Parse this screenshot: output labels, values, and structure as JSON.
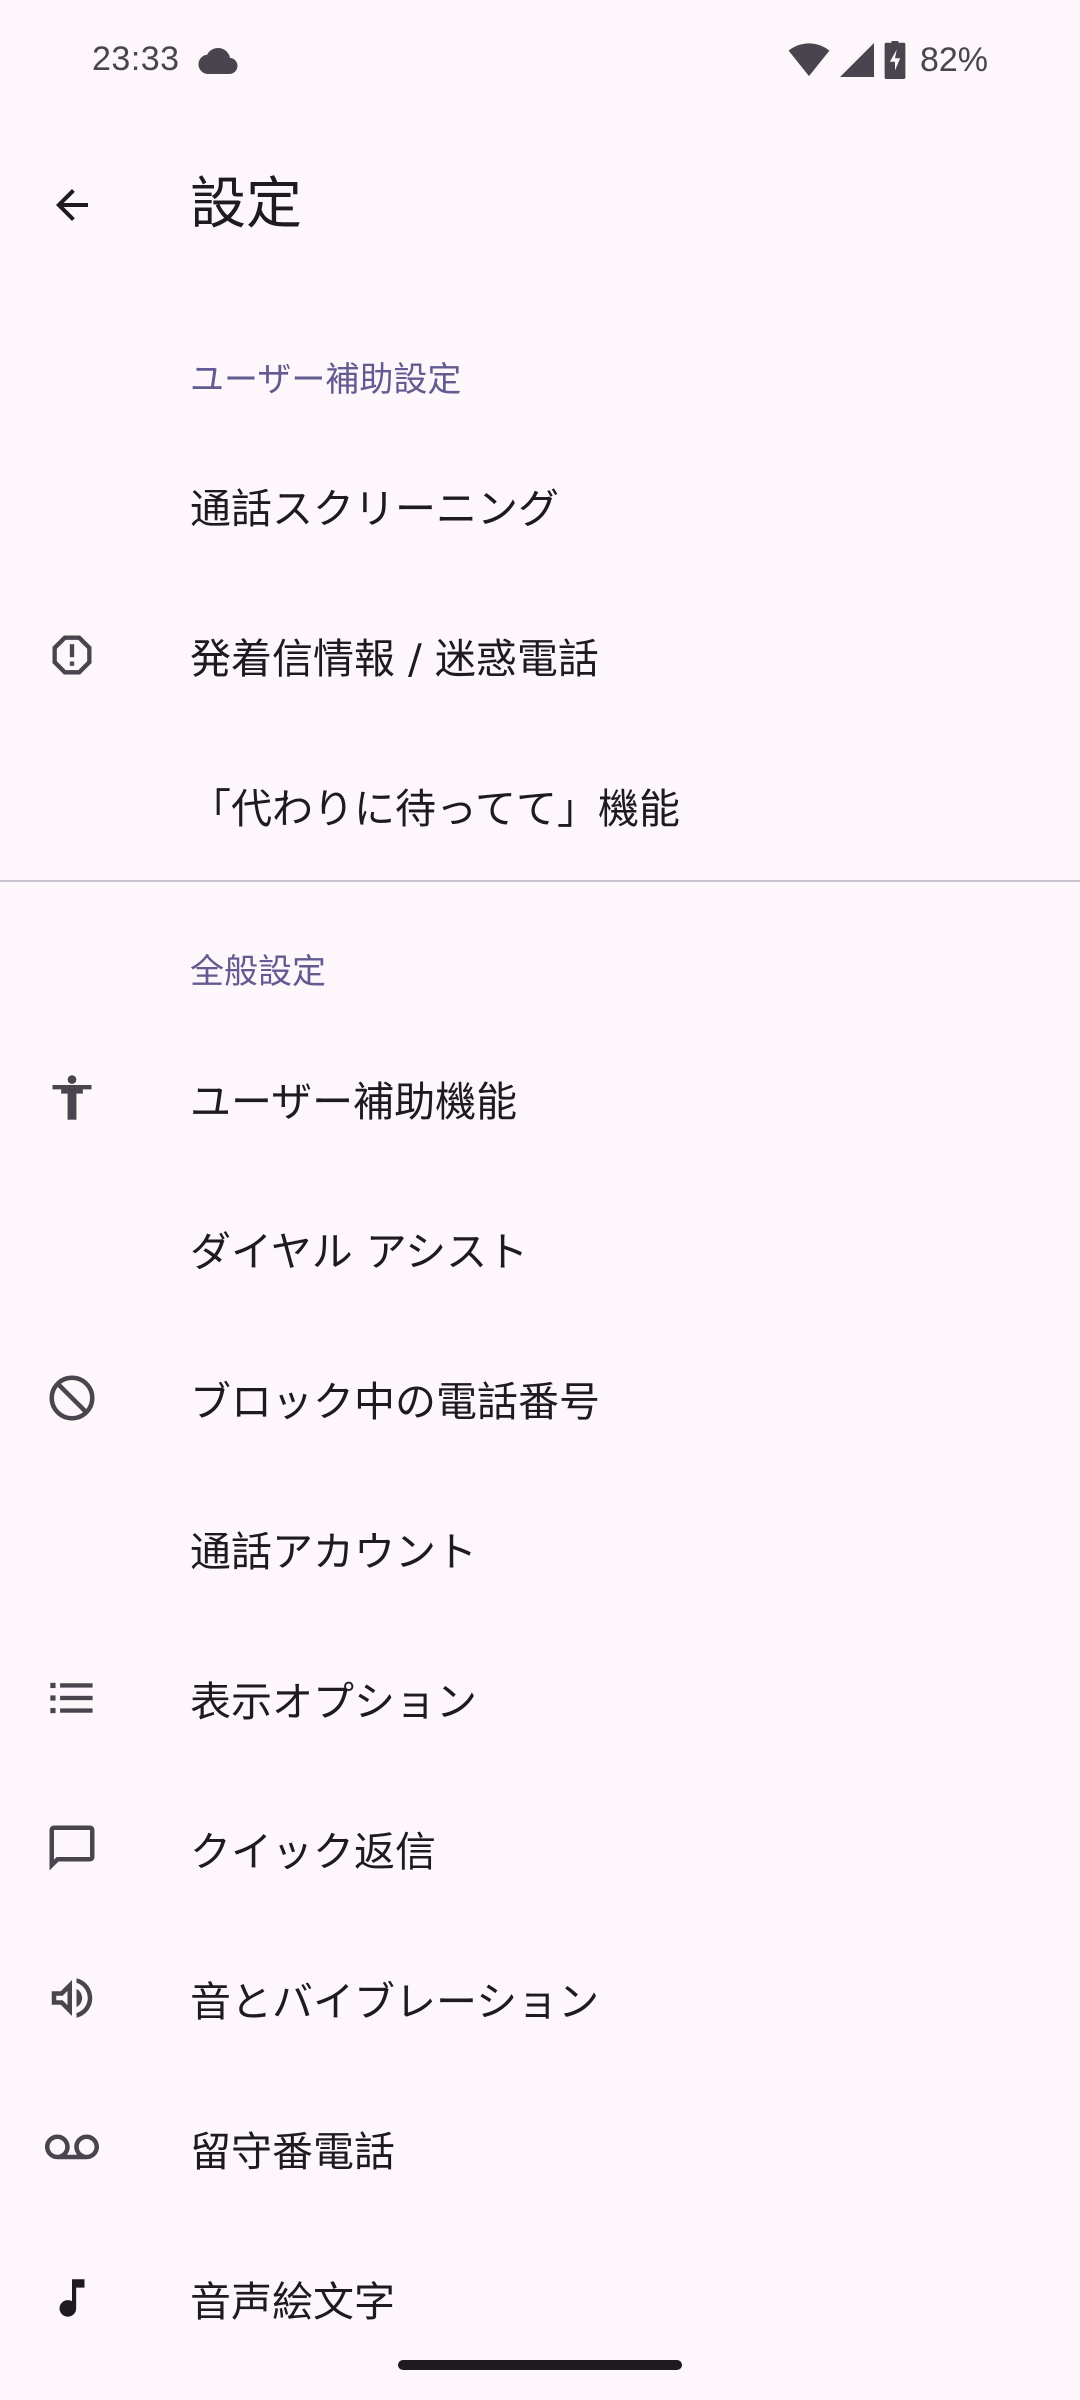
{
  "status_bar": {
    "time": "23:33",
    "battery_percent": "82%",
    "icons": [
      "cloud-icon",
      "wifi-icon",
      "signal-icon",
      "battery-charging-icon"
    ]
  },
  "app_bar": {
    "title": "設定",
    "back_icon": "arrow-back-icon"
  },
  "sections": [
    {
      "header": "ユーザー補助設定",
      "items": [
        {
          "label": "通話スクリーニング",
          "icon": null
        },
        {
          "label": "発着信情報 / 迷惑電話",
          "icon": "report-icon"
        },
        {
          "label": "「代わりに待ってて」機能",
          "icon": null
        }
      ]
    },
    {
      "header": "全般設定",
      "items": [
        {
          "label": "ユーザー補助機能",
          "icon": "accessibility-icon"
        },
        {
          "label": "ダイヤル アシスト",
          "icon": null
        },
        {
          "label": "ブロック中の電話番号",
          "icon": "block-icon"
        },
        {
          "label": "通話アカウント",
          "icon": null
        },
        {
          "label": "表示オプション",
          "icon": "list-icon"
        },
        {
          "label": "クイック返信",
          "icon": "chat-bubble-icon"
        },
        {
          "label": "音とバイブレーション",
          "icon": "volume-icon"
        },
        {
          "label": "留守番電話",
          "icon": "voicemail-icon"
        },
        {
          "label": "音声絵文字",
          "icon": "music-note-icon"
        }
      ]
    }
  ],
  "colors": {
    "background": "#fdf7fb",
    "section_header": "#625b91",
    "text_primary": "#1d1b20",
    "icon": "#49454f"
  }
}
